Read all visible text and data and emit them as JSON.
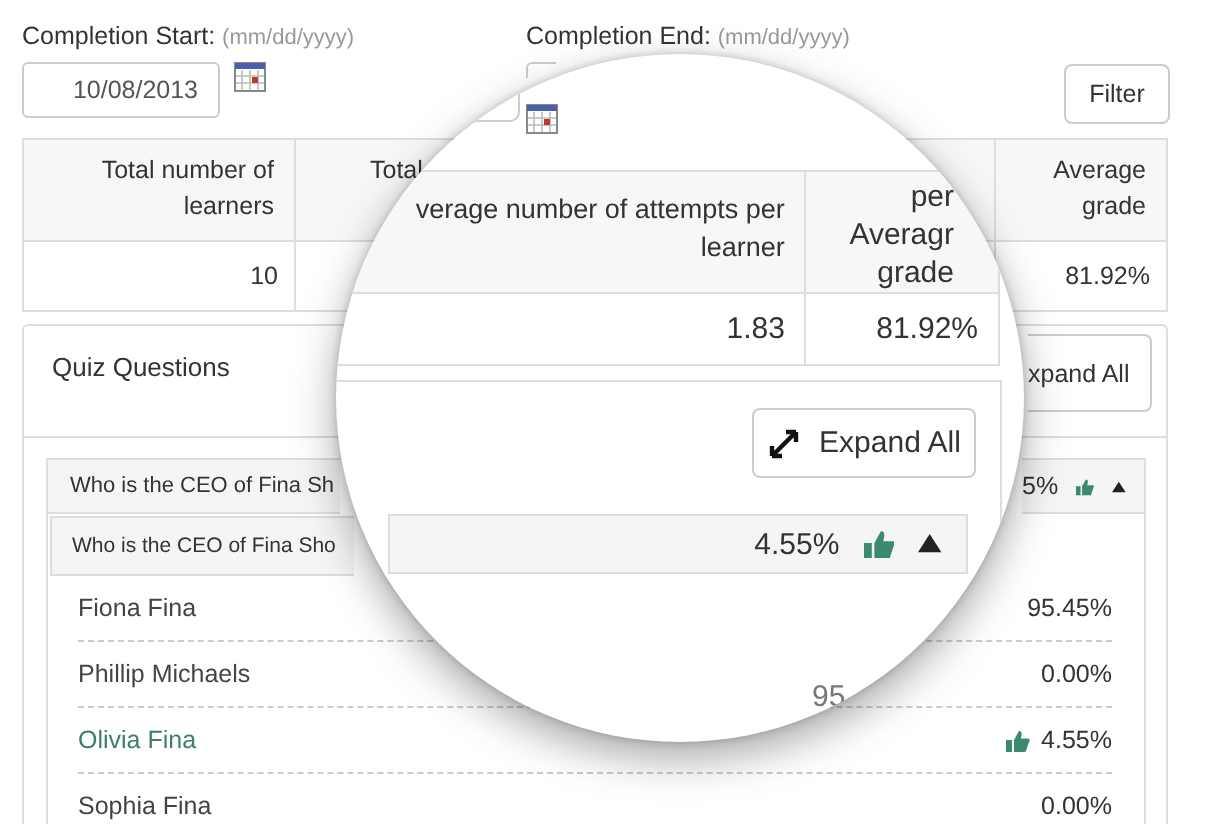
{
  "filters": {
    "start": {
      "label": "Completion Start:",
      "hint": "(mm/dd/yyyy)",
      "value": "10/08/2013"
    },
    "end": {
      "label": "Completion End:",
      "hint": "(mm/dd/yyyy)"
    }
  },
  "filter_button": "Filter",
  "summary_table": {
    "columns": [
      {
        "header": "Total number of learners",
        "value": "10"
      },
      {
        "header": "Total"
      },
      {
        "header": "Average grade",
        "value": "81.92%"
      }
    ]
  },
  "quiz_panel": {
    "title": "Quiz Questions",
    "expand_button": "xpand All",
    "question": {
      "text": "Who is the CEO of Fina Sh",
      "score": "5%",
      "correct": true,
      "expanded": true
    },
    "sub_question": {
      "text": "Who is the CEO of Fina Sho"
    },
    "answers": [
      {
        "name": "Fiona Fina",
        "percent": "95.45%",
        "correct": false
      },
      {
        "name": "Phillip Michaels",
        "percent": "0.00%",
        "correct": false
      },
      {
        "name": "Olivia Fina",
        "percent": "4.55%",
        "correct": true
      },
      {
        "name": "Sophia Fina",
        "percent": "0.00%",
        "correct": false
      }
    ]
  },
  "magnifier": {
    "columns": [
      {
        "header_lines": [
          "verage number of attempts per",
          "learner"
        ],
        "value": "1.83"
      },
      {
        "header_lines": [
          "per",
          "Averagr",
          "grade"
        ],
        "value": "81.92%"
      }
    ],
    "expand_button": "Expand All",
    "sub_question": {
      "score": "4.55%",
      "correct": true,
      "expanded": true
    },
    "fragment": "95"
  }
}
